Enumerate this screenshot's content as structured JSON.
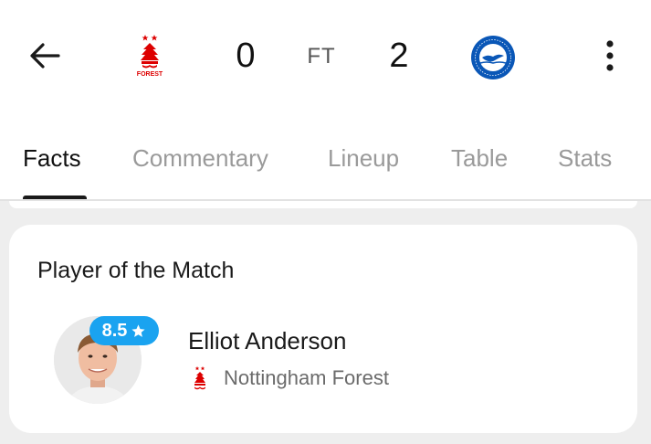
{
  "header": {
    "home_team": "Nottingham Forest",
    "away_team": "Brighton & Hove Albion",
    "home_score": "0",
    "away_score": "2",
    "status": "FT",
    "home_crest_text": "FOREST",
    "icons": {
      "back": "arrow-left-icon",
      "menu": "more-vertical-icon"
    },
    "colors": {
      "home": "#dd0000",
      "away": "#0a57b7"
    }
  },
  "tabs": [
    {
      "label": "Facts",
      "active": true
    },
    {
      "label": "Commentary",
      "active": false
    },
    {
      "label": "Lineup",
      "active": false
    },
    {
      "label": "Table",
      "active": false
    },
    {
      "label": "Stats",
      "active": false
    }
  ],
  "potm": {
    "title": "Player of the Match",
    "rating": "8.5",
    "player_name": "Elliot Anderson",
    "team": "Nottingham Forest",
    "colors": {
      "rating_badge": "#1aa3f0"
    },
    "icons": {
      "rating": "star-icon"
    }
  }
}
